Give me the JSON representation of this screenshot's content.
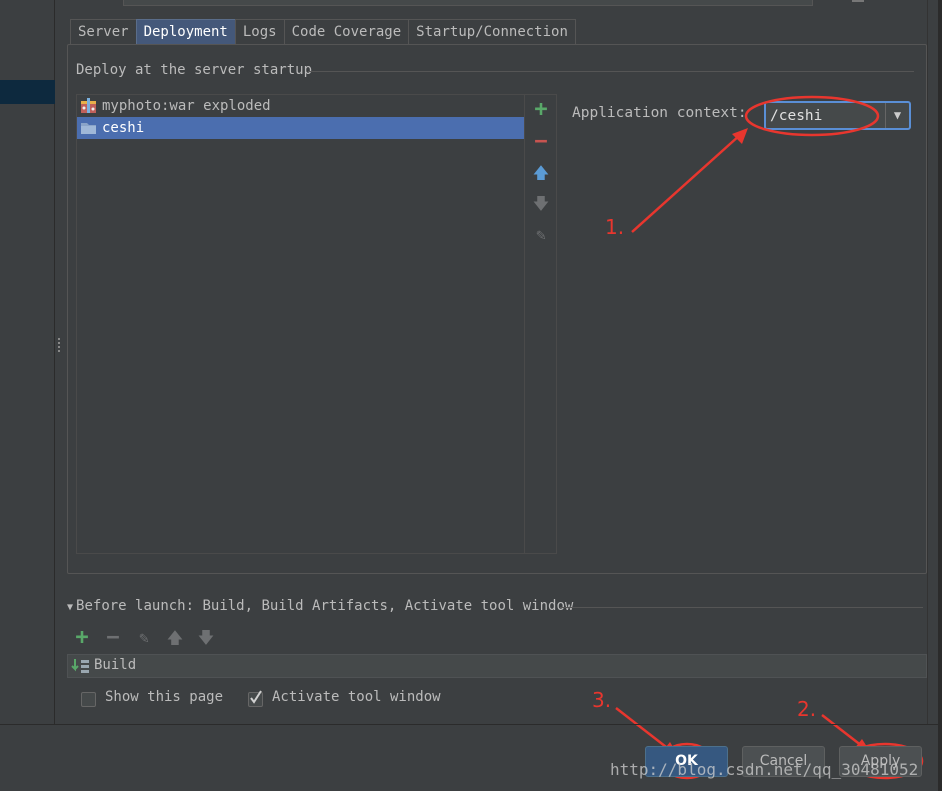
{
  "tabs": [
    {
      "label": "Server"
    },
    {
      "label": "Deployment",
      "active": true
    },
    {
      "label": "Logs"
    },
    {
      "label": "Code Coverage"
    },
    {
      "label": "Startup/Connection"
    }
  ],
  "deployment": {
    "section_title": "Deploy at the server startup",
    "items": [
      {
        "label": "myphoto:war exploded",
        "icon": "war-artifact-icon"
      },
      {
        "label": "ceshi",
        "icon": "folder-icon",
        "selected": true
      }
    ],
    "toolbar": {
      "add": "+",
      "remove": "−",
      "up": "🡅",
      "down": "🡇",
      "edit": "✎"
    },
    "app_context_label": "Application context:",
    "app_context_value": "/ceshi"
  },
  "annotations": {
    "step1": "1.",
    "step2": "2.",
    "step3": "3."
  },
  "before_launch": {
    "title": "Before launch: Build, Build Artifacts, Activate tool window",
    "tasks": [
      {
        "label": "Build"
      }
    ]
  },
  "options": {
    "show_this_page": {
      "label": "Show this page",
      "checked": false
    },
    "activate_tool_window": {
      "label": "Activate tool window",
      "checked": true
    }
  },
  "buttons": {
    "ok": "OK",
    "cancel": "Cancel",
    "apply": "Apply"
  },
  "watermark": "http://blog.csdn.net/qq_30481052",
  "colors": {
    "background": "#3c3f41",
    "selection": "#4b6eaf",
    "annotation_red": "#e8362e",
    "add_green": "#59a869",
    "remove_red": "#c75450",
    "arrow_blue": "#5b9bd5"
  }
}
